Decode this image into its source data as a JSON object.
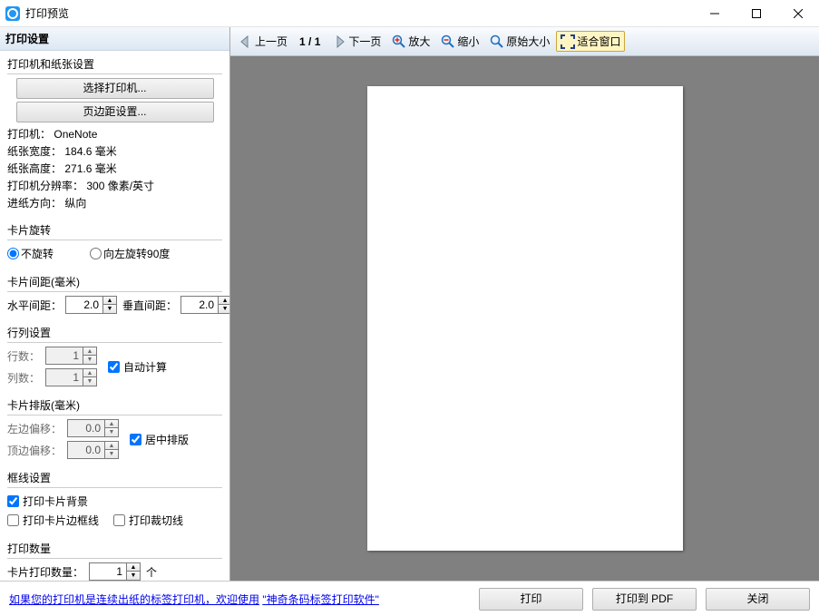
{
  "title": "打印预览",
  "sidebar": {
    "title": "打印设置",
    "printer_group_title": "打印机和纸张设置",
    "select_printer_btn": "选择打印机...",
    "margin_btn": "页边距设置...",
    "printer_label": "打印机：",
    "printer_value": "OneNote",
    "paper_width_label": "纸张宽度：",
    "paper_width_value": "184.6 毫米",
    "paper_height_label": "纸张高度：",
    "paper_height_value": "271.6 毫米",
    "dpi_label": "打印机分辨率：",
    "dpi_value": "300 像素/英寸",
    "feed_label": "进纸方向：",
    "feed_value": "纵向",
    "rotate_group_title": "卡片旋转",
    "rotate_none": "不旋转",
    "rotate_left90": "向左旋转90度",
    "spacing_group_title": "卡片间距(毫米)",
    "hspacing_label": "水平间距：",
    "hspacing_value": "2.0",
    "vspacing_label": "垂直间距：",
    "vspacing_value": "2.0",
    "rowcol_group_title": "行列设置",
    "rows_label": "行数：",
    "rows_value": "1",
    "cols_label": "列数：",
    "cols_value": "1",
    "auto_calc": "自动计算",
    "layout_group_title": "卡片排版(毫米)",
    "left_offset_label": "左边偏移：",
    "left_offset_value": "0.0",
    "top_offset_label": "顶边偏移：",
    "top_offset_value": "0.0",
    "center_layout": "居中排版",
    "border_group_title": "框线设置",
    "print_bg": "打印卡片背景",
    "print_border": "打印卡片边框线",
    "print_cut": "打印裁切线",
    "count_group_title": "打印数量",
    "count_label": "卡片打印数量：",
    "count_value": "1",
    "count_unit": "个"
  },
  "toolbar": {
    "prev": "上一页",
    "next": "下一页",
    "page": "1 / 1",
    "zoom_in": "放大",
    "zoom_out": "缩小",
    "zoom_reset": "原始大小",
    "fit": "适合窗口"
  },
  "footer": {
    "link_a": "如果您的打印机是连续出纸的标签打印机，欢迎使用",
    "link_b": "\"神奇条码标签打印软件\"",
    "print": "打印",
    "print_pdf": "打印到 PDF",
    "close": "关闭"
  }
}
